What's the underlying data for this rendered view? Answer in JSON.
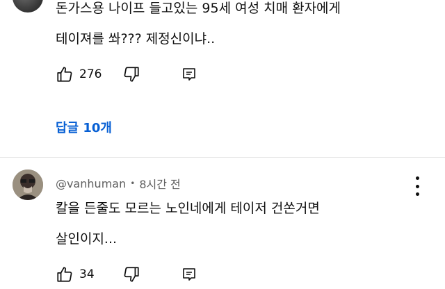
{
  "comment1": {
    "text_line1": "돈가스용 나이프 들고있는 95세 여성 치매 환자에게",
    "text_line2": "테이져를 쏴??? 제정신이냐..",
    "likes": "276"
  },
  "replies_label": "답글 10개",
  "comment2": {
    "author": "@vanhuman",
    "time": "8시간 전",
    "separator": "•",
    "text_line1": "칼을 든줄도 모르는 노인네에게  테이저 건쏜거면",
    "text_line2": "살인이지...",
    "likes": "34"
  },
  "icons": {
    "like": "thumbs-up-icon",
    "dislike": "thumbs-down-icon",
    "reply": "comment-reply-icon",
    "menu": "more-vert-icon"
  },
  "colors": {
    "text": "#0f0f0f",
    "secondary_text": "#606060",
    "link": "#065fd4",
    "divider": "#e5e5e5"
  }
}
